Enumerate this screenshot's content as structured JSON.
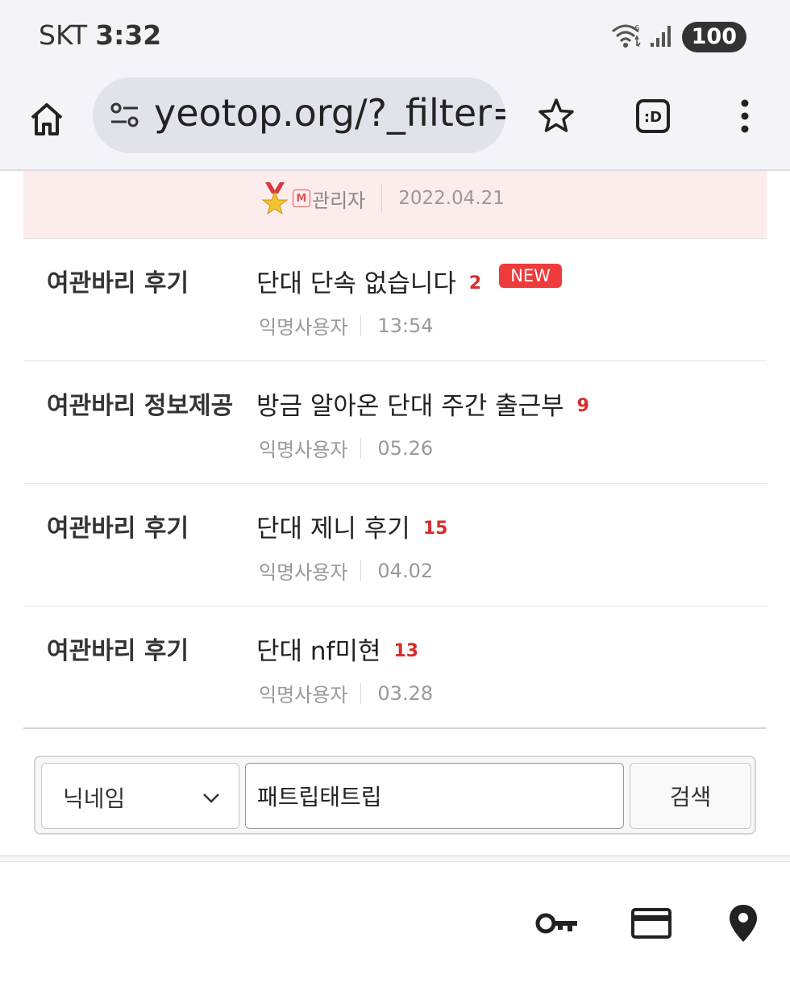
{
  "status_bar": {
    "carrier": "SKT",
    "time": "3:32",
    "battery": "100"
  },
  "browser": {
    "url": "yeotop.org/?_filter=",
    "icons": [
      "home-icon",
      "tune-icon",
      "star-icon",
      "tab-switcher-icon",
      "more-vert-icon"
    ],
    "tab_label": ":D"
  },
  "notice": {
    "author_mark": "M",
    "author": "관리자",
    "date": "2022.04.21"
  },
  "posts": [
    {
      "category": "여관바리 후기",
      "title": "단대 단속 없습니다",
      "comments": "2",
      "badge": "NEW",
      "author": "익명사용자",
      "date": "13:54"
    },
    {
      "category": "여관바리 정보제공",
      "title": "방금 알아온 단대 주간 출근부",
      "comments": "9",
      "badge": "",
      "author": "익명사용자",
      "date": "05.26"
    },
    {
      "category": "여관바리 후기",
      "title": "단대 제니 후기",
      "comments": "15",
      "badge": "",
      "author": "익명사용자",
      "date": "04.02"
    },
    {
      "category": "여관바리 후기",
      "title": "단대 nf미현",
      "comments": "13",
      "badge": "",
      "author": "익명사용자",
      "date": "03.28"
    }
  ],
  "search": {
    "field_selected": "닉네임",
    "query": "패트립태트립",
    "button_label": "검색"
  },
  "bottom_bar": {
    "icons": [
      "key-icon",
      "credit-card-icon",
      "location-pin-icon"
    ]
  },
  "colors": {
    "accent_red": "#d62d2d",
    "new_badge": "#ee3b3b",
    "notice_bg": "#fdecec",
    "chrome_bg": "#f4f4f8"
  }
}
